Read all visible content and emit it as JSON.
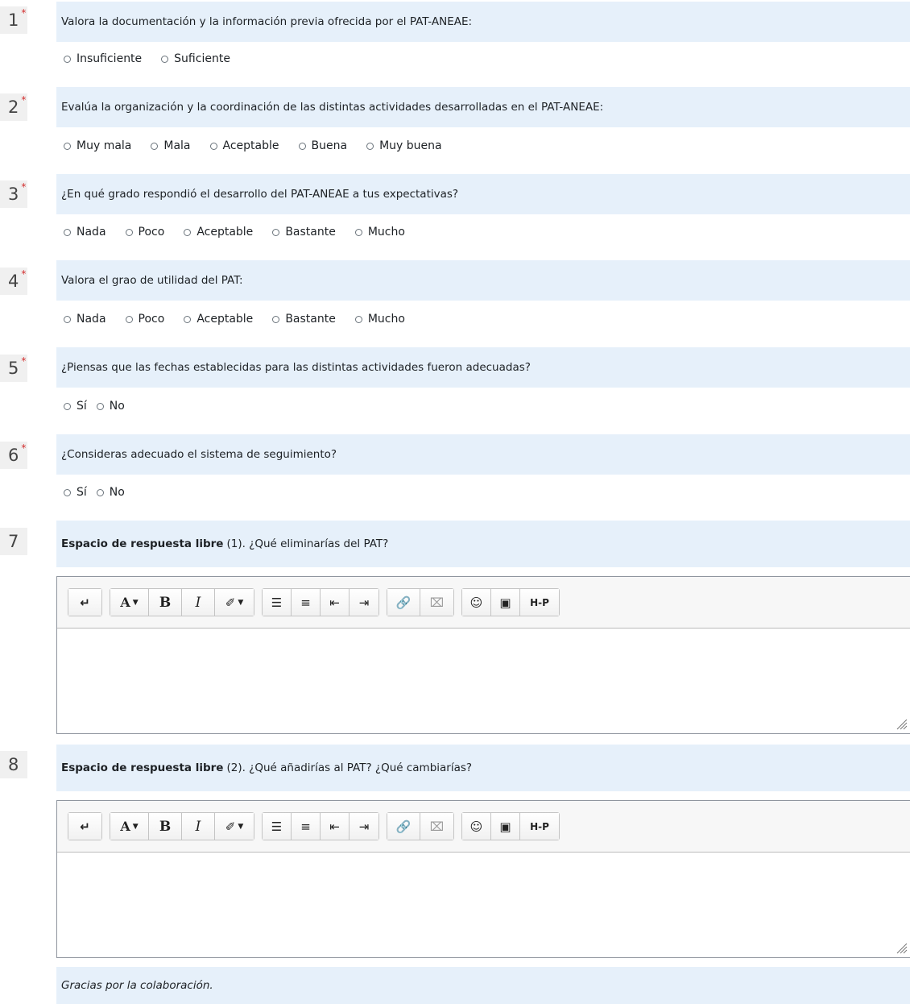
{
  "questions": [
    {
      "number": "1",
      "required": "*",
      "text": "Valora la documentación y la información previa ofrecida por el PAT-ANEAE:",
      "options": [
        "Insuficiente",
        "Suficiente"
      ]
    },
    {
      "number": "2",
      "required": "*",
      "text": "Evalúa la organización y la coordinación de las distintas actividades desarrolladas en el PAT-ANEAE:",
      "options": [
        "Muy mala",
        "Mala",
        "Aceptable",
        "Buena",
        "Muy buena"
      ]
    },
    {
      "number": "3",
      "required": "*",
      "text": "¿En qué grado respondió el desarrollo del PAT-ANEAE a tus expectativas?",
      "options": [
        "Nada",
        "Poco",
        "Aceptable",
        "Bastante",
        "Mucho"
      ]
    },
    {
      "number": "4",
      "required": "*",
      "text": "Valora el grao de utilidad del PAT:",
      "options": [
        "Nada",
        "Poco",
        "Aceptable",
        "Bastante",
        "Mucho"
      ]
    },
    {
      "number": "5",
      "required": "*",
      "text": "¿Piensas que las fechas establecidas para las distintas actividades fueron adecuadas?",
      "options": [
        "Sí",
        "No"
      ]
    },
    {
      "number": "6",
      "required": "*",
      "text": "¿Consideras adecuado el sistema de seguimiento?",
      "options": [
        "Sí",
        "No"
      ]
    },
    {
      "number": "7",
      "bold": "Espacio de respuesta libre",
      "text": "(1). ¿Qué eliminarías del PAT?"
    },
    {
      "number": "8",
      "bold": "Espacio de respuesta libre",
      "text": "(2). ¿Qué añadirías al PAT? ¿Qué cambiarías?"
    }
  ],
  "toolbar": {
    "font_size_label": "A",
    "bold_label": "B",
    "italic_label": "I",
    "h5p_label": "H-P"
  },
  "thanks": "Gracias por la colaboración."
}
